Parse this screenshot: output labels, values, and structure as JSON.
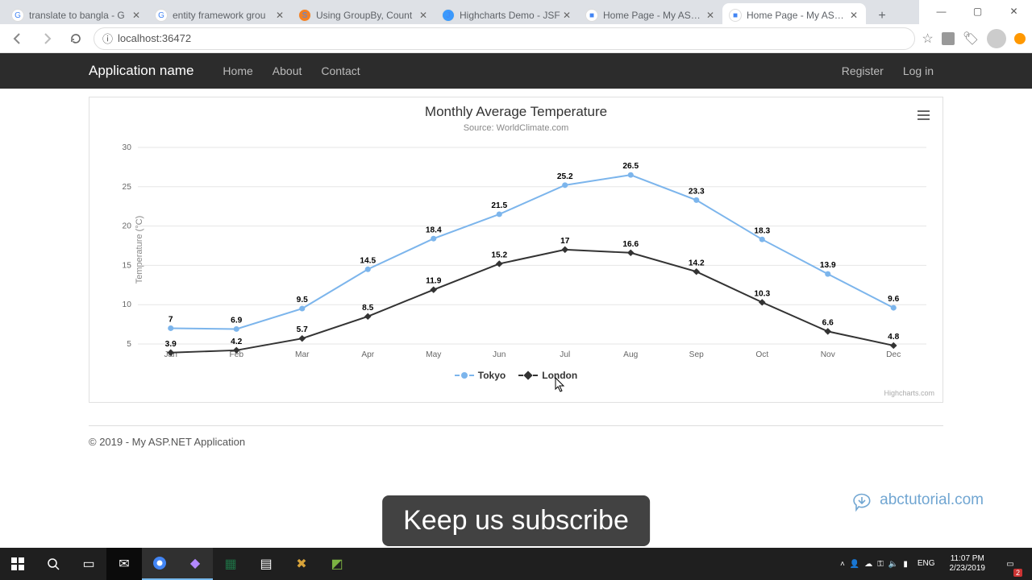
{
  "browser": {
    "tabs": [
      {
        "title": "translate to bangla - G",
        "icon": "G",
        "iconBg": "#fff",
        "active": false
      },
      {
        "title": "entity framework grou",
        "icon": "G",
        "iconBg": "#fff",
        "active": false
      },
      {
        "title": "Using GroupBy, Count",
        "icon": "S",
        "iconBg": "#f48024",
        "active": false
      },
      {
        "title": "Highcharts Demo - JSF",
        "icon": "J",
        "iconBg": "#3b99fc",
        "active": false
      },
      {
        "title": "Home Page - My ASP.N",
        "icon": "■",
        "iconBg": "#fff",
        "active": false
      },
      {
        "title": "Home Page - My ASP.N",
        "icon": "■",
        "iconBg": "#fff",
        "active": true
      }
    ],
    "url": "localhost:36472"
  },
  "navbar": {
    "brand": "Application name",
    "links": [
      "Home",
      "About",
      "Contact"
    ],
    "register": "Register",
    "login": "Log in"
  },
  "chart_data": {
    "type": "line",
    "title": "Monthly Average Temperature",
    "subtitle": "Source: WorldClimate.com",
    "xlabel": "",
    "ylabel": "Temperature (°C)",
    "categories": [
      "Jan",
      "Feb",
      "Mar",
      "Apr",
      "May",
      "Jun",
      "Jul",
      "Aug",
      "Sep",
      "Oct",
      "Nov",
      "Dec"
    ],
    "ylim": [
      5,
      30
    ],
    "yticks": [
      5,
      10,
      15,
      20,
      25,
      30
    ],
    "series": [
      {
        "name": "Tokyo",
        "color": "#7cb5ec",
        "marker": "circle",
        "values": [
          7.0,
          6.9,
          9.5,
          14.5,
          18.4,
          21.5,
          25.2,
          26.5,
          23.3,
          18.3,
          13.9,
          9.6
        ]
      },
      {
        "name": "London",
        "color": "#333333",
        "marker": "diamond",
        "values": [
          3.9,
          4.2,
          5.7,
          8.5,
          11.9,
          15.2,
          17.0,
          16.6,
          14.2,
          10.3,
          6.6,
          4.8
        ]
      }
    ],
    "credits": "Highcharts.com"
  },
  "footer": "© 2019 - My ASP.NET Application",
  "brand_logo": "abctutorial.com",
  "banner": "Keep us subscribe",
  "tray": {
    "lang": "ENG",
    "time": "11:07 PM",
    "date": "2/23/2019",
    "notif_count": "2"
  }
}
